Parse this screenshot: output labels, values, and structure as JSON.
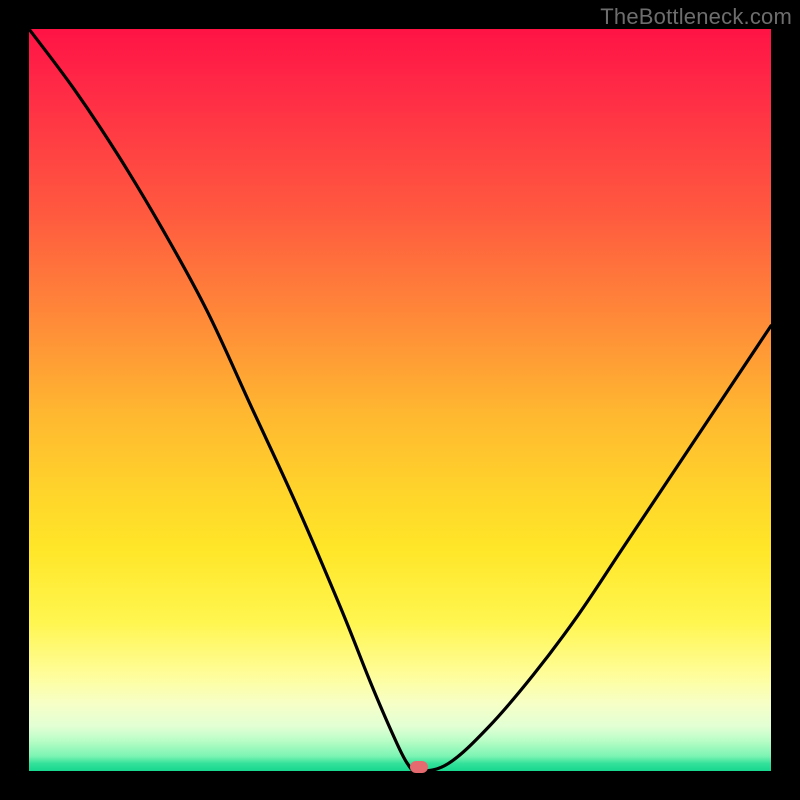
{
  "watermark": "TheBottleneck.com",
  "chart_data": {
    "type": "line",
    "title": "",
    "xlabel": "",
    "ylabel": "",
    "xlim": [
      0,
      100
    ],
    "ylim": [
      0,
      100
    ],
    "grid": false,
    "series": [
      {
        "name": "bottleneck-curve",
        "x": [
          0,
          6,
          12,
          18,
          24,
          30,
          36,
          42,
          46,
          49,
          51,
          52.5,
          56.5,
          62,
          68,
          74,
          80,
          86,
          92,
          98,
          100
        ],
        "values": [
          100,
          92,
          83,
          73,
          62,
          49,
          36,
          22,
          12,
          5,
          1,
          0,
          1,
          6,
          13,
          21,
          30,
          39,
          48,
          57,
          60
        ]
      }
    ],
    "marker": {
      "x": 52.5,
      "y": 0.5,
      "color": "#e46a6f"
    },
    "gradient_stops": [
      {
        "pos": 0,
        "color": "#ff1345"
      },
      {
        "pos": 25,
        "color": "#ff5a3f"
      },
      {
        "pos": 52,
        "color": "#ffb830"
      },
      {
        "pos": 80,
        "color": "#fff650"
      },
      {
        "pos": 95,
        "color": "#d8ffd0"
      },
      {
        "pos": 100,
        "color": "#17d78f"
      }
    ]
  }
}
